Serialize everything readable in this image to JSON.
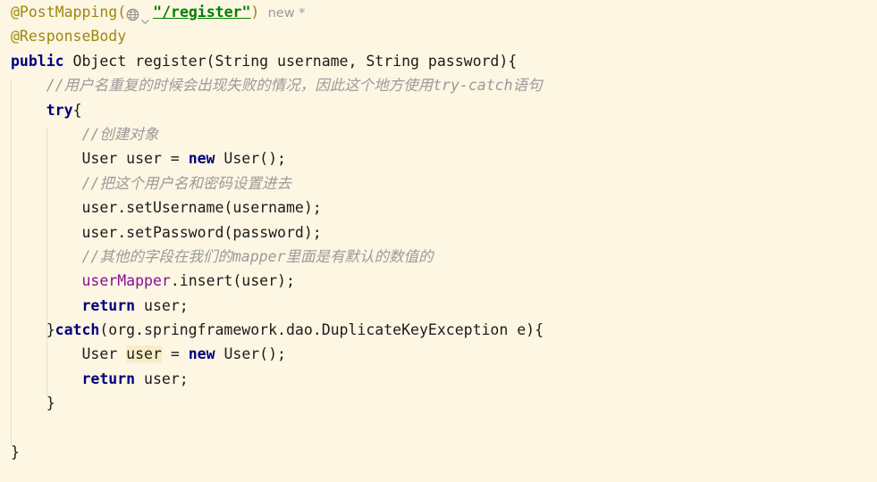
{
  "editor": {
    "kind": "java-code-editor",
    "background_color": "#FDF6E3",
    "caret_identifier_highlight_color": "#F7EDC4",
    "indent_guide_color": "#E6DFC8",
    "colors": {
      "annotation": "#9E880D",
      "keyword": "#000080",
      "string": "#008000",
      "comment": "#9A9A9A",
      "field": "#871094",
      "plain_text": "#1B1B1B",
      "inlay_hint": "#9A9A9A"
    },
    "gutter_icons": [
      {
        "name": "globe-icon",
        "tooltip": "web-request-mapping",
        "line": 1
      },
      {
        "name": "chevron-down-icon",
        "tooltip": "expand-mapping",
        "line": 1
      }
    ],
    "inlay_hints": [
      {
        "line": 1,
        "text": "new *"
      }
    ],
    "lines": [
      {
        "num": 1,
        "segments": [
          {
            "type": "annotation",
            "text": "@PostMapping("
          },
          {
            "type": "icon",
            "text": "globe"
          },
          {
            "type": "string",
            "text": "\"/register\""
          },
          {
            "type": "annotation",
            "text": ")"
          },
          {
            "type": "hint",
            "text": "  new *"
          }
        ]
      },
      {
        "num": 2,
        "segments": [
          {
            "type": "annotation",
            "text": "@ResponseBody"
          }
        ]
      },
      {
        "num": 3,
        "segments": [
          {
            "type": "keyword",
            "text": "public"
          },
          {
            "type": "plain",
            "text": " Object register(String username, String password){"
          }
        ]
      },
      {
        "num": 4,
        "segments": [
          {
            "type": "comment",
            "text": "    //用户名重复的时候会出现失败的情况，因此这个地方使用try-catch语句"
          }
        ]
      },
      {
        "num": 5,
        "segments": [
          {
            "type": "plain",
            "text": "    "
          },
          {
            "type": "keyword",
            "text": "try"
          },
          {
            "type": "plain",
            "text": "{"
          }
        ]
      },
      {
        "num": 6,
        "segments": [
          {
            "type": "comment",
            "text": "        //创建对象"
          }
        ]
      },
      {
        "num": 7,
        "segments": [
          {
            "type": "plain",
            "text": "        User user = "
          },
          {
            "type": "keyword",
            "text": "new"
          },
          {
            "type": "plain",
            "text": " User();"
          }
        ]
      },
      {
        "num": 8,
        "segments": [
          {
            "type": "comment",
            "text": "        //把这个用户名和密码设置进去"
          }
        ]
      },
      {
        "num": 9,
        "segments": [
          {
            "type": "plain",
            "text": "        user.setUsername(username);"
          }
        ]
      },
      {
        "num": 10,
        "segments": [
          {
            "type": "plain",
            "text": "        user.setPassword(password);"
          }
        ]
      },
      {
        "num": 11,
        "segments": [
          {
            "type": "comment",
            "text": "        //其他的字段在我们的mapper里面是有默认的数值的"
          }
        ]
      },
      {
        "num": 12,
        "segments": [
          {
            "type": "plain",
            "text": "        "
          },
          {
            "type": "field",
            "text": "userMapper"
          },
          {
            "type": "plain",
            "text": ".insert(user);"
          }
        ]
      },
      {
        "num": 13,
        "segments": [
          {
            "type": "plain",
            "text": "        "
          },
          {
            "type": "keyword",
            "text": "return"
          },
          {
            "type": "plain",
            "text": " user;"
          }
        ]
      },
      {
        "num": 14,
        "segments": [
          {
            "type": "plain",
            "text": "    }"
          },
          {
            "type": "keyword",
            "text": "catch"
          },
          {
            "type": "plain",
            "text": "(org.springframework.dao.DuplicateKeyException e){"
          }
        ]
      },
      {
        "num": 15,
        "segments": [
          {
            "type": "plain",
            "text": "        User "
          },
          {
            "type": "highlight",
            "text": "user"
          },
          {
            "type": "plain",
            "text": " = "
          },
          {
            "type": "keyword",
            "text": "new"
          },
          {
            "type": "plain",
            "text": " User();"
          }
        ]
      },
      {
        "num": 16,
        "segments": [
          {
            "type": "plain",
            "text": "        "
          },
          {
            "type": "keyword",
            "text": "return"
          },
          {
            "type": "plain",
            "text": " user;"
          }
        ]
      },
      {
        "num": 17,
        "segments": [
          {
            "type": "plain",
            "text": "    }"
          }
        ]
      },
      {
        "num": 18,
        "segments": []
      },
      {
        "num": 19,
        "segments": [
          {
            "type": "plain",
            "text": "}"
          }
        ]
      }
    ]
  }
}
